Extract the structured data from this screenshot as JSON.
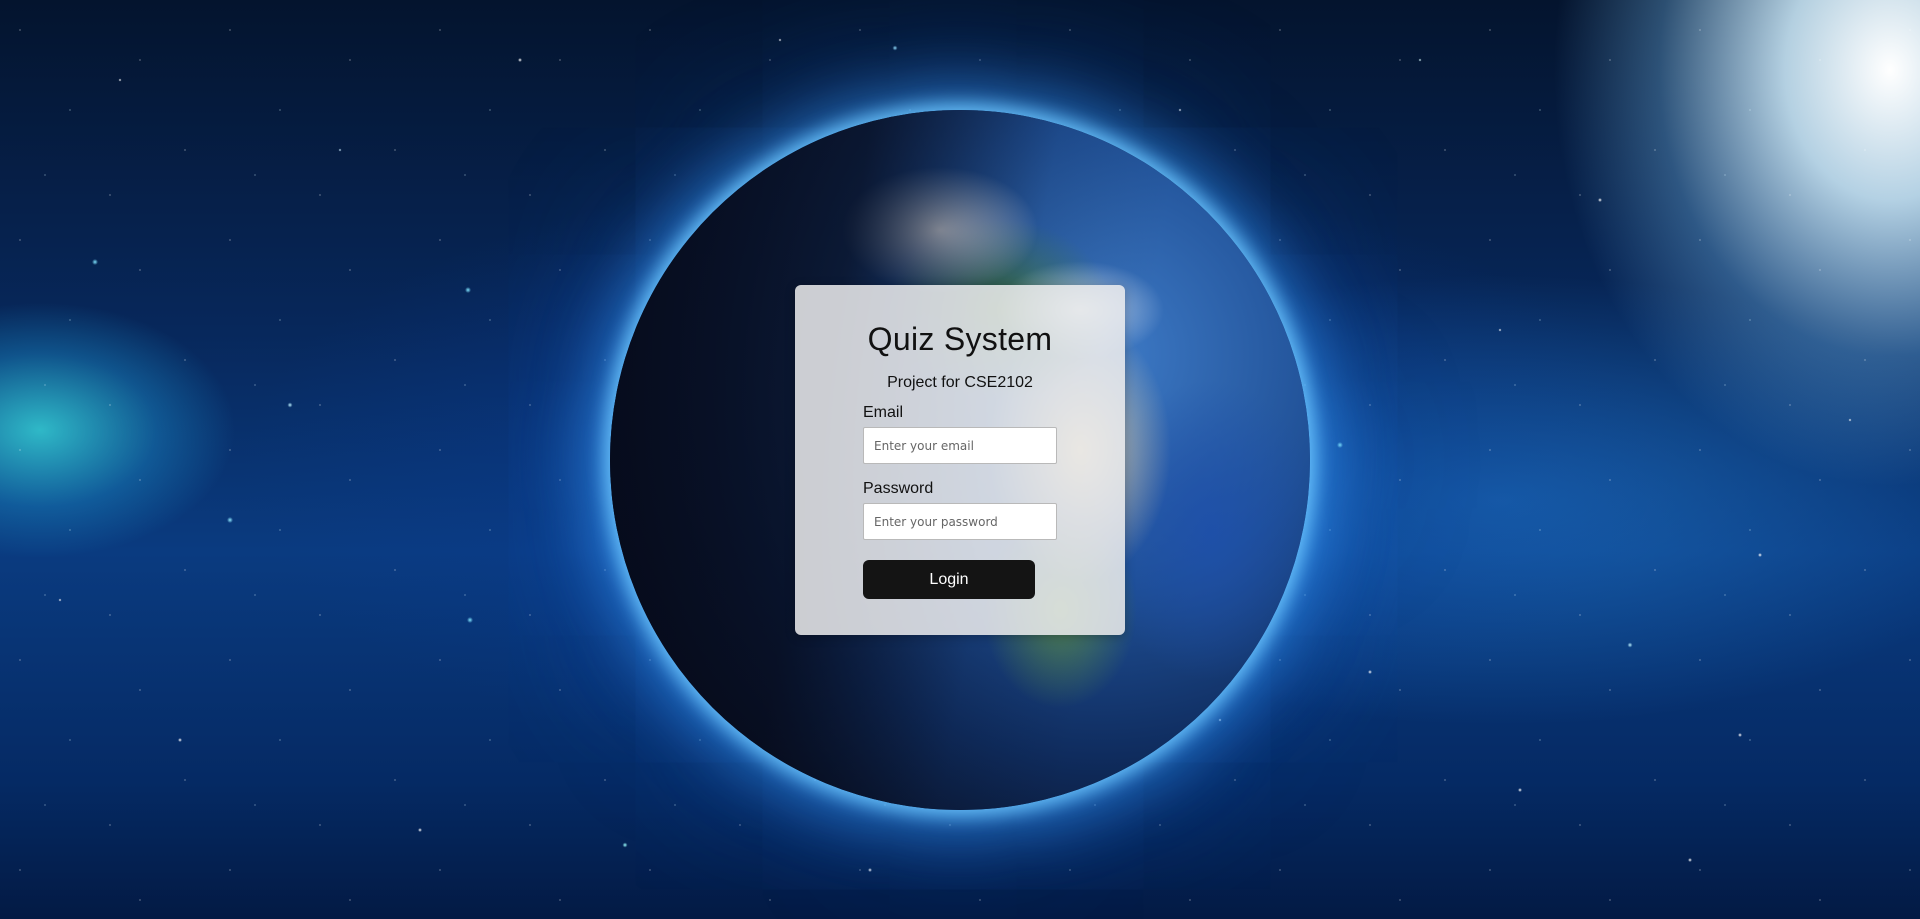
{
  "background": {
    "scene": "space-earth-background"
  },
  "login_card": {
    "title": "Quiz System",
    "subtitle": "Project for CSE2102",
    "email": {
      "label": "Email",
      "value": "",
      "placeholder": "Enter your email"
    },
    "password": {
      "label": "Password",
      "value": "",
      "placeholder": "Enter your password"
    },
    "login_label": "Login"
  },
  "colors": {
    "button_bg": "#141414",
    "button_text": "#ffffff",
    "card_bg": "#ececee"
  }
}
